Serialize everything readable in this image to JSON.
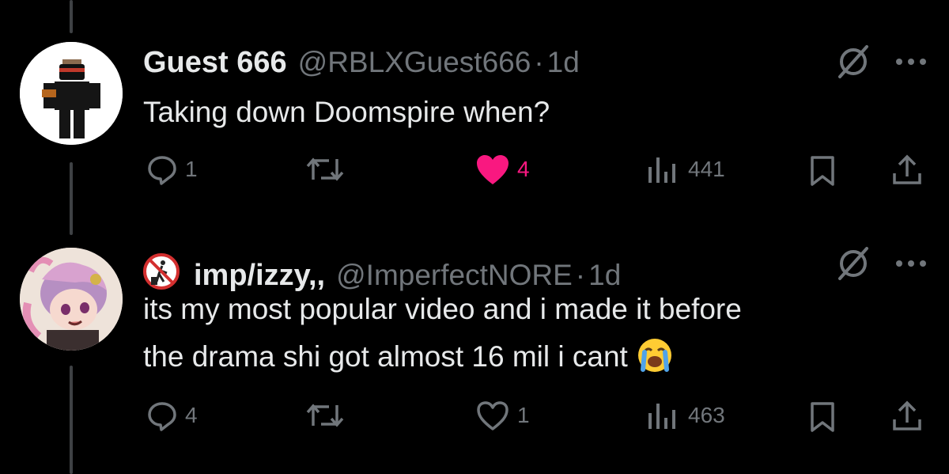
{
  "tweets": [
    {
      "display_name": "Guest 666",
      "handle": "@RBLXGuest666",
      "separator": "·",
      "time": "1d",
      "text_lines": [
        "Taking down Doomspire when?"
      ],
      "avatar_icon": "roblox-guest-avatar",
      "replies": "1",
      "retweets": "",
      "likes": "4",
      "liked": true,
      "views": "441"
    },
    {
      "display_name": "imp/izzy,,",
      "handle": "@ImperfectNORE",
      "separator": "·",
      "time": "1d",
      "text_lines": [
        "its my most popular video and i made it before",
        "the drama shi got almost 16 mil i cant"
      ],
      "name_badge_icon": "no-littering-emoji",
      "trailing_emoji_icon": "loudly-crying-face-emoji",
      "avatar_icon": "anime-girl-avatar",
      "replies": "4",
      "retweets": "",
      "likes": "1",
      "liked": false,
      "views": "463"
    }
  ],
  "colors": {
    "background": "#000000",
    "primary_text": "#e7e9ea",
    "secondary_text": "#71767b",
    "like_active": "#f91880",
    "thread_line": "#3e4144"
  }
}
